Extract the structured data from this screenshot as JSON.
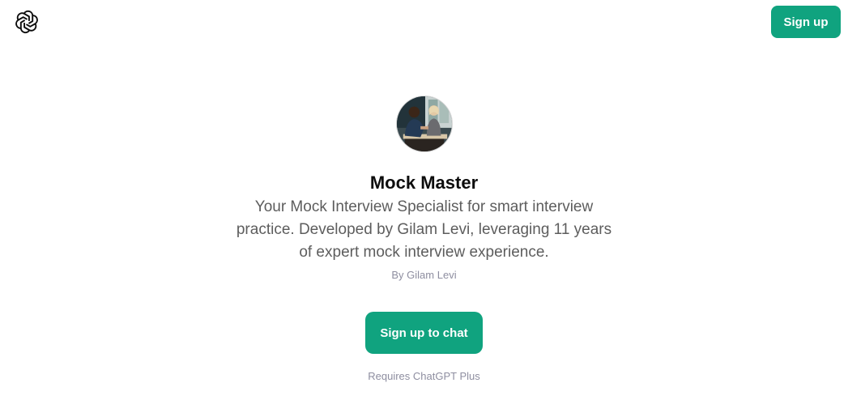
{
  "header": {
    "logo_icon": "openai-logo-icon",
    "signup_label": "Sign up"
  },
  "gpt": {
    "avatar_icon": "handshake-interview-avatar",
    "title": "Mock Master",
    "description": "Your Mock Interview Specialist for smart interview practice. Developed by Gilam Levi, leveraging 11 years of expert mock interview experience.",
    "author": "By Gilam Levi",
    "cta_label": "Sign up to chat",
    "requirement": "Requires ChatGPT Plus"
  },
  "colors": {
    "accent": "#10a37f",
    "muted_text": "#8e8ea0",
    "body_text": "#5d5d5d"
  }
}
